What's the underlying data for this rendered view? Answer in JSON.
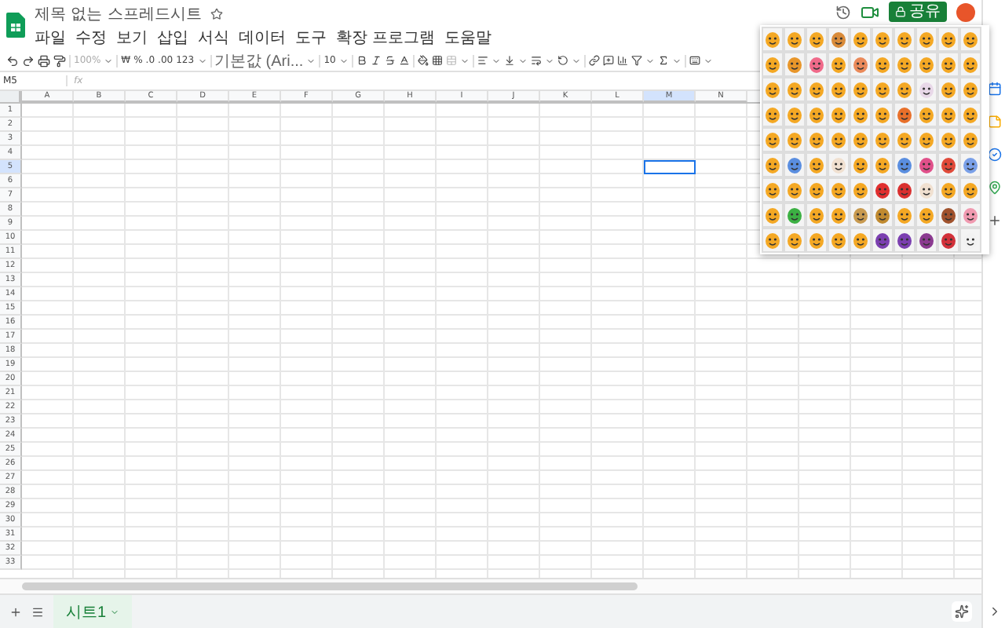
{
  "app": {
    "title": "제목 없는 스프레드시트"
  },
  "menu": [
    "파일",
    "수정",
    "보기",
    "삽입",
    "서식",
    "데이터",
    "도구",
    "확장 프로그램",
    "도움말"
  ],
  "toolbar": {
    "zoom": "100%",
    "currency": "₩",
    "percent": "%",
    "decrease_decimal": ".0",
    "increase_decimal": ".00",
    "number_format": "123",
    "font": "기본값 (Ari...",
    "font_size": "10"
  },
  "name_box": "M5",
  "fx": "fx",
  "share": {
    "label": "공유"
  },
  "columns": [
    {
      "label": "A",
      "selected": false
    },
    {
      "label": "B",
      "selected": false
    },
    {
      "label": "C",
      "selected": false
    },
    {
      "label": "D",
      "selected": false
    },
    {
      "label": "E",
      "selected": false
    },
    {
      "label": "F",
      "selected": false
    },
    {
      "label": "G",
      "selected": false
    },
    {
      "label": "H",
      "selected": false
    },
    {
      "label": "I",
      "selected": false
    },
    {
      "label": "J",
      "selected": false
    },
    {
      "label": "K",
      "selected": false
    },
    {
      "label": "L",
      "selected": false
    },
    {
      "label": "M",
      "selected": true
    },
    {
      "label": "N",
      "selected": false
    }
  ],
  "rows": [
    {
      "label": "1",
      "selected": false
    },
    {
      "label": "2",
      "selected": false
    },
    {
      "label": "3",
      "selected": false
    },
    {
      "label": "4",
      "selected": false
    },
    {
      "label": "5",
      "selected": true
    },
    {
      "label": "6",
      "selected": false
    },
    {
      "label": "7",
      "selected": false
    },
    {
      "label": "8",
      "selected": false
    },
    {
      "label": "9",
      "selected": false
    },
    {
      "label": "10",
      "selected": false
    },
    {
      "label": "11",
      "selected": false
    },
    {
      "label": "12",
      "selected": false
    },
    {
      "label": "13",
      "selected": false
    },
    {
      "label": "14",
      "selected": false
    },
    {
      "label": "15",
      "selected": false
    },
    {
      "label": "16",
      "selected": false
    },
    {
      "label": "17",
      "selected": false
    },
    {
      "label": "18",
      "selected": false
    },
    {
      "label": "19",
      "selected": false
    },
    {
      "label": "20",
      "selected": false
    },
    {
      "label": "21",
      "selected": false
    },
    {
      "label": "22",
      "selected": false
    },
    {
      "label": "23",
      "selected": false
    },
    {
      "label": "24",
      "selected": false
    },
    {
      "label": "25",
      "selected": false
    },
    {
      "label": "26",
      "selected": false
    },
    {
      "label": "27",
      "selected": false
    },
    {
      "label": "28",
      "selected": false
    },
    {
      "label": "29",
      "selected": false
    },
    {
      "label": "30",
      "selected": false
    },
    {
      "label": "31",
      "selected": false
    },
    {
      "label": "32",
      "selected": false
    },
    {
      "label": "33",
      "selected": false
    }
  ],
  "emoji_rows": [
    [
      {
        "color": "#f4a824"
      },
      {
        "color": "#f4a824"
      },
      {
        "color": "#f4a824"
      },
      {
        "color": "#d98b3a"
      },
      {
        "color": "#f4a824"
      },
      {
        "color": "#f4a824"
      },
      {
        "color": "#f4a824"
      },
      {
        "color": "#f4a824"
      },
      {
        "color": "#f4a824"
      },
      {
        "color": "#f4a824"
      }
    ],
    [
      {
        "color": "#f4a824"
      },
      {
        "color": "#e8962a"
      },
      {
        "color": "#f06a8a"
      },
      {
        "color": "#f4a824"
      },
      {
        "color": "#ea8a5a"
      },
      {
        "color": "#f4a824"
      },
      {
        "color": "#f4a824"
      },
      {
        "color": "#f4a824"
      },
      {
        "color": "#f4a824"
      },
      {
        "color": "#f4a824"
      }
    ],
    [
      {
        "color": "#f4a824"
      },
      {
        "color": "#f4a824"
      },
      {
        "color": "#f4a824"
      },
      {
        "color": "#f4a824"
      },
      {
        "color": "#f4a824"
      },
      {
        "color": "#f4a824"
      },
      {
        "color": "#f4a824"
      },
      {
        "color": "#e8d8e8"
      },
      {
        "color": "#f4a824"
      },
      {
        "color": "#f4a824"
      }
    ],
    [
      {
        "color": "#f4a824"
      },
      {
        "color": "#f4a824"
      },
      {
        "color": "#f4a824"
      },
      {
        "color": "#f4a824"
      },
      {
        "color": "#f4a824"
      },
      {
        "color": "#f4a824"
      },
      {
        "color": "#e8702a"
      },
      {
        "color": "#f4a824"
      },
      {
        "color": "#f4a824"
      },
      {
        "color": "#f4a824"
      }
    ],
    [
      {
        "color": "#f4a824"
      },
      {
        "color": "#f4a824"
      },
      {
        "color": "#f4a824"
      },
      {
        "color": "#f4a824"
      },
      {
        "color": "#f4a824"
      },
      {
        "color": "#f4a824"
      },
      {
        "color": "#f4a824"
      },
      {
        "color": "#f4a824"
      },
      {
        "color": "#f4a824"
      },
      {
        "color": "#f4a824"
      }
    ],
    [
      {
        "color": "#f4a824"
      },
      {
        "color": "#5a8ee0"
      },
      {
        "color": "#f4a824"
      },
      {
        "color": "#f0e0d0"
      },
      {
        "color": "#f4a824"
      },
      {
        "color": "#f4a824"
      },
      {
        "color": "#5a8ee0"
      },
      {
        "color": "#e0508a"
      },
      {
        "color": "#e04a3a"
      },
      {
        "color": "#7aa0e8"
      }
    ],
    [
      {
        "color": "#f4a824"
      },
      {
        "color": "#f4a824"
      },
      {
        "color": "#f4a824"
      },
      {
        "color": "#f4a824"
      },
      {
        "color": "#f4a824"
      },
      {
        "color": "#e02f2f"
      },
      {
        "color": "#d9302f"
      },
      {
        "color": "#f0e0d0"
      },
      {
        "color": "#f4a824"
      },
      {
        "color": "#f4a824"
      }
    ],
    [
      {
        "color": "#f4a824"
      },
      {
        "color": "#3cb043"
      },
      {
        "color": "#f4a824"
      },
      {
        "color": "#f4a824"
      },
      {
        "color": "#c89a50"
      },
      {
        "color": "#c08a30"
      },
      {
        "color": "#f4a824"
      },
      {
        "color": "#f4a824"
      },
      {
        "color": "#a0522d"
      },
      {
        "color": "#f09ab0"
      }
    ],
    [
      {
        "color": "#f4a824"
      },
      {
        "color": "#f4a824"
      },
      {
        "color": "#f4a824"
      },
      {
        "color": "#f4a824"
      },
      {
        "color": "#f4a824"
      },
      {
        "color": "#7b3fb0"
      },
      {
        "color": "#7b3fb0"
      },
      {
        "color": "#8b3a90"
      },
      {
        "color": "#d2313a"
      },
      {
        "color": "#f2f2f2"
      }
    ]
  ],
  "sheet_tabs": [
    {
      "label": "시트1",
      "selected": true
    }
  ]
}
